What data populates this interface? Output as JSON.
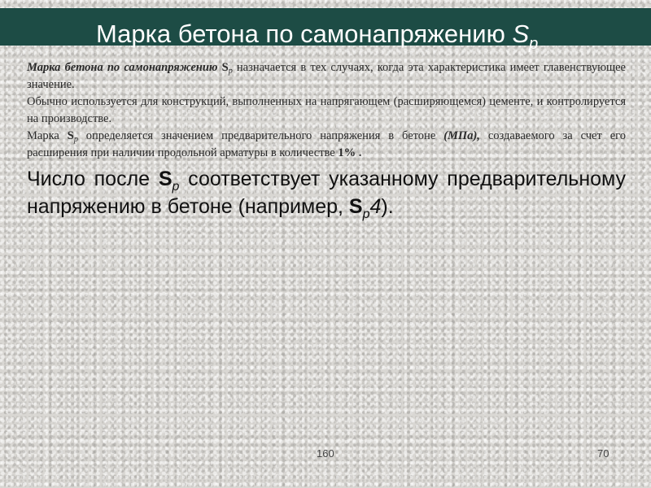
{
  "header": {
    "title": "Марка бетона по самонапряжению ",
    "title_symbol": "S",
    "title_symbol_sub": "p"
  },
  "paragraph_1": {
    "lead_bold_italic": "Марка бетона по самонапряжению",
    "symbol": "S",
    "symbol_sub": "p",
    "rest": " назначается в тех случаях, когда эта характеристика имеет главенствующее значение."
  },
  "paragraph_2": {
    "text": "Обычно используется для конструкций, выполненных на напрягающем (расширяющемся) цементе, и контролируется на производстве."
  },
  "paragraph_3": {
    "before": "Марка ",
    "symbol": "S",
    "symbol_sub": "p",
    "middle": " определяется значением предварительного напряжения в бетоне ",
    "unit": "(МПа),",
    "after": " создаваемого за счет его расширения при наличии продольной арматуры в количестве ",
    "percent": "1% ."
  },
  "paragraph_4": {
    "before": "Число после ",
    "symbol": "S",
    "symbol_sub": "p",
    "middle": " соответствует указанному предварительному напряжению в бетоне (например, ",
    "example_symbol": "S",
    "example_sub": "p",
    "example_value": "4",
    "after": ")."
  },
  "footer": {
    "page_center": "160",
    "page_right": "70"
  },
  "colors": {
    "title_bar": "#1d4c45",
    "title_text": "#ffffff",
    "background": "#d9d7d3"
  }
}
